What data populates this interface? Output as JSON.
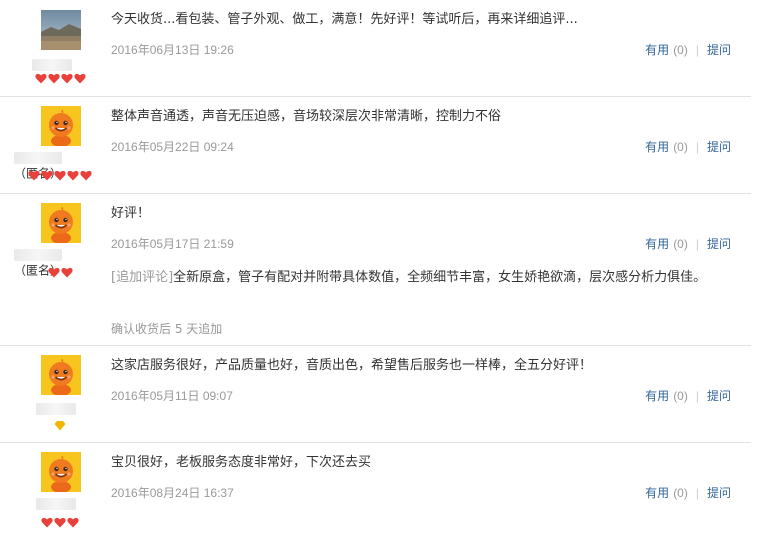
{
  "reviews": [
    {
      "content": "今天收货...看包装、管子外观、做工，满意！先好评！等试听后，再来详细追评...",
      "date": "2016年06月13日 19:26",
      "useful_label": "有用",
      "useful_count": "(0)",
      "ask_label": "提问",
      "username": "",
      "anon_label": "",
      "avatar": "landscape-photo",
      "rank_icon": "red-heart-icon",
      "rank_count": 4
    },
    {
      "content": "整体声音通透，声音无压迫感，音场较深层次非常清晰，控制力不俗",
      "date": "2016年05月22日 09:24",
      "useful_label": "有用",
      "useful_count": "(0)",
      "ask_label": "提问",
      "username": "",
      "anon_label": "（匿名）",
      "avatar": "orange-mascot",
      "rank_icon": "red-heart-icon",
      "rank_count": 5
    },
    {
      "content": "好评！",
      "date": "2016年05月17日 21:59",
      "useful_label": "有用",
      "useful_count": "(0)",
      "ask_label": "提问",
      "username": "",
      "anon_label": "（匿名）",
      "avatar": "orange-mascot",
      "rank_icon": "red-heart-icon",
      "rank_count": 2,
      "append": {
        "tag": "[追加评论]",
        "text": "全新原盒，管子有配对并附带具体数值，全频细节丰富，女生娇艳欲滴，层次感分析力俱佳。",
        "note": "确认收货后 5 天追加"
      }
    },
    {
      "content": "这家店服务很好，产品质量也好，音质出色，希望售后服务也一样棒，全五分好评！",
      "date": "2016年05月11日 09:07",
      "useful_label": "有用",
      "useful_count": "(0)",
      "ask_label": "提问",
      "username": "",
      "anon_label": "",
      "avatar": "orange-mascot",
      "rank_icon": "yellow-diamond-icon",
      "rank_count": 1
    },
    {
      "content": "宝贝很好，老板服务态度非常好，下次还去买",
      "date": "2016年08月24日 16:37",
      "useful_label": "有用",
      "useful_count": "(0)",
      "ask_label": "提问",
      "username": "",
      "anon_label": "",
      "avatar": "orange-mascot",
      "rank_icon": "red-heart-icon",
      "rank_count": 3
    }
  ],
  "colors": {
    "link": "#336699",
    "muted": "#999999",
    "heart": "#e8403a",
    "diamond": "#f2b705",
    "divider": "#e2e2e2"
  }
}
